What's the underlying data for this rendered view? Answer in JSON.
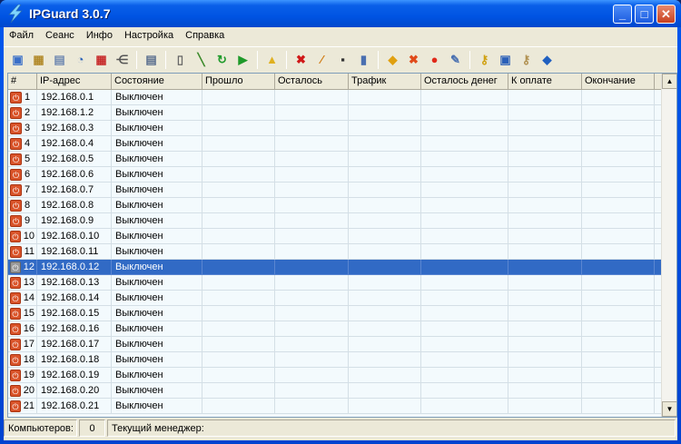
{
  "window": {
    "title": "IPGuard 3.0.7",
    "minimize": "_",
    "maximize": "□",
    "close": "✕"
  },
  "menu": [
    "Файл",
    "Сеанс",
    "Инфо",
    "Настройка",
    "Справка"
  ],
  "toolbar": [
    {
      "name": "monitor-icon",
      "glyph": "▣",
      "color": "#3a6fc8"
    },
    {
      "name": "computer-money-icon",
      "glyph": "▦",
      "color": "#b28a2a"
    },
    {
      "name": "window-icon",
      "glyph": "▤",
      "color": "#6d87b0"
    },
    {
      "name": "user-clock-icon",
      "glyph": "◔",
      "color": "#2b62b8"
    },
    {
      "name": "computer-money-red-icon",
      "glyph": "▦",
      "color": "#c72a2a"
    },
    {
      "name": "network-icon",
      "glyph": "⋲",
      "color": "#555"
    },
    {
      "sep": true
    },
    {
      "name": "save-icon",
      "glyph": "▤",
      "color": "#566b8c"
    },
    {
      "sep": true
    },
    {
      "name": "clipboard-icon",
      "glyph": "▯",
      "color": "#666"
    },
    {
      "name": "broom-icon",
      "glyph": "╲",
      "color": "#3b8a2a"
    },
    {
      "name": "refresh-icon",
      "glyph": "↻",
      "color": "#1f9a2a"
    },
    {
      "name": "play-icon",
      "glyph": "▶",
      "color": "#1f9a2a"
    },
    {
      "sep": true
    },
    {
      "name": "lock-icon",
      "glyph": "▲",
      "color": "#e0b020"
    },
    {
      "sep": true
    },
    {
      "name": "delete-icon",
      "glyph": "✖",
      "color": "#d01818"
    },
    {
      "name": "wand-icon",
      "glyph": "⁄",
      "color": "#d07a10"
    },
    {
      "name": "cable-icon",
      "glyph": "▪",
      "color": "#333"
    },
    {
      "name": "door-icon",
      "glyph": "▮",
      "color": "#4a6fb0"
    },
    {
      "sep": true
    },
    {
      "name": "warning-icon",
      "glyph": "◆",
      "color": "#e0a010"
    },
    {
      "name": "cancel-icon",
      "glyph": "✖",
      "color": "#e04a1a"
    },
    {
      "name": "angry-face-icon",
      "glyph": "●",
      "color": "#e02a1a"
    },
    {
      "name": "edit-icon",
      "glyph": "✎",
      "color": "#4a70b0"
    },
    {
      "sep": true
    },
    {
      "name": "key-icon",
      "glyph": "⚷",
      "color": "#d0a010"
    },
    {
      "name": "settings-window-icon",
      "glyph": "▣",
      "color": "#2a5fb8"
    },
    {
      "name": "key-doc-icon",
      "glyph": "⚷",
      "color": "#b09050"
    },
    {
      "name": "info-icon",
      "glyph": "◆",
      "color": "#2060c0"
    }
  ],
  "columns": [
    "#",
    "IP-адрес",
    "Состояние",
    "Прошло",
    "Осталось",
    "Трафик",
    "Осталось денег",
    "К оплате",
    "Окончание"
  ],
  "rows": [
    [
      "1",
      "192.168.0.1",
      "Выключен"
    ],
    [
      "2",
      "192.168.1.2",
      "Выключен"
    ],
    [
      "3",
      "192.168.0.3",
      "Выключен"
    ],
    [
      "4",
      "192.168.0.4",
      "Выключен"
    ],
    [
      "5",
      "192.168.0.5",
      "Выключен"
    ],
    [
      "6",
      "192.168.0.6",
      "Выключен"
    ],
    [
      "7",
      "192.168.0.7",
      "Выключен"
    ],
    [
      "8",
      "192.168.0.8",
      "Выключен"
    ],
    [
      "9",
      "192.168.0.9",
      "Выключен"
    ],
    [
      "10",
      "192.168.0.10",
      "Выключен"
    ],
    [
      "11",
      "192.168.0.11",
      "Выключен"
    ],
    [
      "12",
      "192.168.0.12",
      "Выключен"
    ],
    [
      "13",
      "192.168.0.13",
      "Выключен"
    ],
    [
      "14",
      "192.168.0.14",
      "Выключен"
    ],
    [
      "15",
      "192.168.0.15",
      "Выключен"
    ],
    [
      "16",
      "192.168.0.16",
      "Выключен"
    ],
    [
      "17",
      "192.168.0.17",
      "Выключен"
    ],
    [
      "18",
      "192.168.0.18",
      "Выключен"
    ],
    [
      "19",
      "192.168.0.19",
      "Выключен"
    ],
    [
      "20",
      "192.168.0.20",
      "Выключен"
    ],
    [
      "21",
      "192.168.0.21",
      "Выключен"
    ]
  ],
  "selected_row": 12,
  "status": {
    "computers_label": "Компьютеров:",
    "computers_count": "0",
    "manager_label": "Текущий менеджер:"
  }
}
